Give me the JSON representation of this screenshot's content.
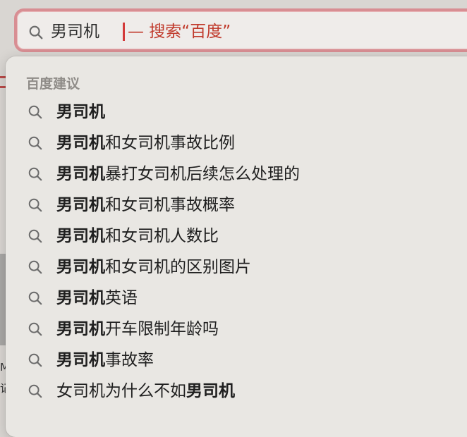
{
  "search": {
    "query": "男司机",
    "completion_hint": "— 搜索“百度”"
  },
  "popup": {
    "section_header": "百度建议",
    "suggestions": [
      {
        "bold": "男司机",
        "rest": "",
        "bold_tail": ""
      },
      {
        "bold": "男司机",
        "rest": "和女司机事故比例",
        "bold_tail": ""
      },
      {
        "bold": "男司机",
        "rest": "暴打女司机后续怎么处理的",
        "bold_tail": ""
      },
      {
        "bold": "男司机",
        "rest": "和女司机事故概率",
        "bold_tail": ""
      },
      {
        "bold": "男司机",
        "rest": "和女司机人数比",
        "bold_tail": ""
      },
      {
        "bold": "男司机",
        "rest": "和女司机的区别图片",
        "bold_tail": ""
      },
      {
        "bold": "男司机",
        "rest": "英语",
        "bold_tail": ""
      },
      {
        "bold": "男司机",
        "rest": "开车限制年龄吗",
        "bold_tail": ""
      },
      {
        "bold": "男司机",
        "rest": "事故率",
        "bold_tail": ""
      },
      {
        "bold": "",
        "rest": "女司机为什么不如",
        "bold_tail": "男司机"
      }
    ]
  },
  "background": {
    "fragment_1": "M",
    "fragment_2": "记"
  },
  "colors": {
    "accent": "#d33a3a",
    "focus_ring": "#d88e93",
    "popup_bg": "#e9e7e3"
  },
  "icons": {
    "search": "magnifying-glass"
  }
}
